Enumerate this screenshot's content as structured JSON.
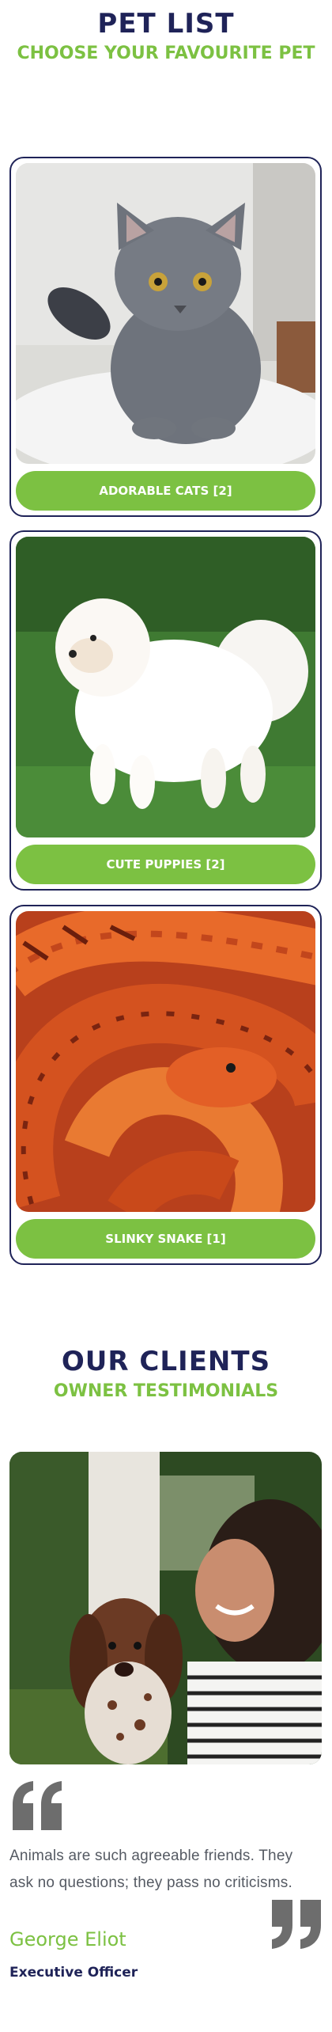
{
  "pets_section": {
    "title": "PET LIST",
    "subtitle": "CHOOSE YOUR FAVOURITE PET",
    "cards": [
      {
        "label": "ADORABLE CATS [2]",
        "image": "gray-kitten-photo"
      },
      {
        "label": "CUTE PUPPIES [2]",
        "image": "white-pomeranian-photo"
      },
      {
        "label": "SLINKY SNAKE [1]",
        "image": "orange-corn-snake-photo"
      }
    ]
  },
  "clients_section": {
    "title": "OUR CLIENTS",
    "subtitle": "OWNER TESTIMONIALS",
    "testimonial": {
      "image": "woman-with-spaniel-puppy-photo",
      "quote": "Animals are such agreeable friends. They ask no questions; they pass no criticisms.",
      "author": "George Eliot",
      "role": "Executive Officer"
    }
  },
  "colors": {
    "navy": "#1f2358",
    "green": "#7cc142",
    "quote_gray": "#6d6d6d",
    "text_gray": "#555a63"
  },
  "icons": [
    "quote-open-icon",
    "quote-close-icon"
  ]
}
